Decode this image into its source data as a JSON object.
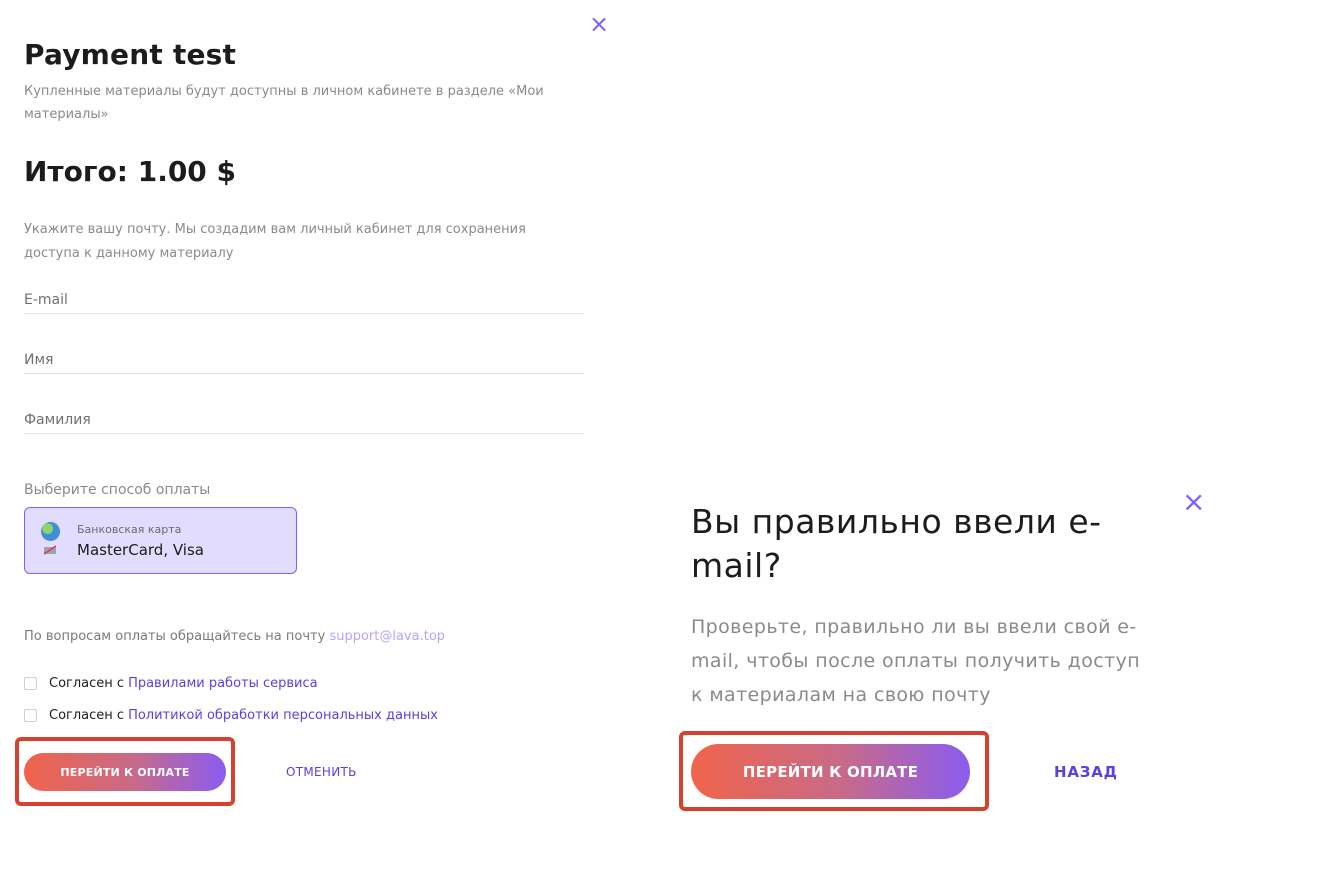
{
  "form": {
    "close_symbol": "×",
    "title": "Payment test",
    "subtitle": "Купленные материалы будут доступны в личном кабинете в разделе «Мои материалы»",
    "total": "Итого: 1.00  $",
    "email_hint": "Укажите вашу почту. Мы создадим вам личный кабинет для сохранения доступа к данному материалу",
    "fields": {
      "email_placeholder": "E-mail",
      "name_placeholder": "Имя",
      "surname_placeholder": "Фамилия"
    },
    "payment_method_label": "Выберите способ оплаты",
    "payment_option": {
      "caption": "Банковская карта",
      "value": "MasterCard, Visa",
      "icons": [
        "globe-icon",
        "card-icon"
      ]
    },
    "support": {
      "text": "По вопросам оплаты обращайтесь на почту",
      "email": "support@lava.top"
    },
    "agreements": [
      {
        "prefix": "Согласен с",
        "link": "Правилами работы сервиса"
      },
      {
        "prefix": "Согласен с",
        "link": "Политикой обработки персональных данных"
      }
    ],
    "pay_button": "ПЕРЕЙТИ К ОПЛАТЕ",
    "cancel_button": "ОТМЕНИТЬ"
  },
  "confirm_modal": {
    "close_symbol": "×",
    "title": "Вы правильно ввели e-mail?",
    "text": "Проверьте, правильно ли вы ввели свой e-mail, чтобы после оплаты получить доступ к материалам на свою почту",
    "pay_button": "ПЕРЕЙТИ К ОПЛАТЕ",
    "back_button": "НАЗАД"
  },
  "colors": {
    "accent": "#5b3fe0",
    "accent_light": "#7b61ff",
    "selected_bg": "#e2dcff",
    "highlight": "#d5402f",
    "gradient": [
      "#f0644a",
      "#c76a8a",
      "#8a5cf0"
    ]
  }
}
